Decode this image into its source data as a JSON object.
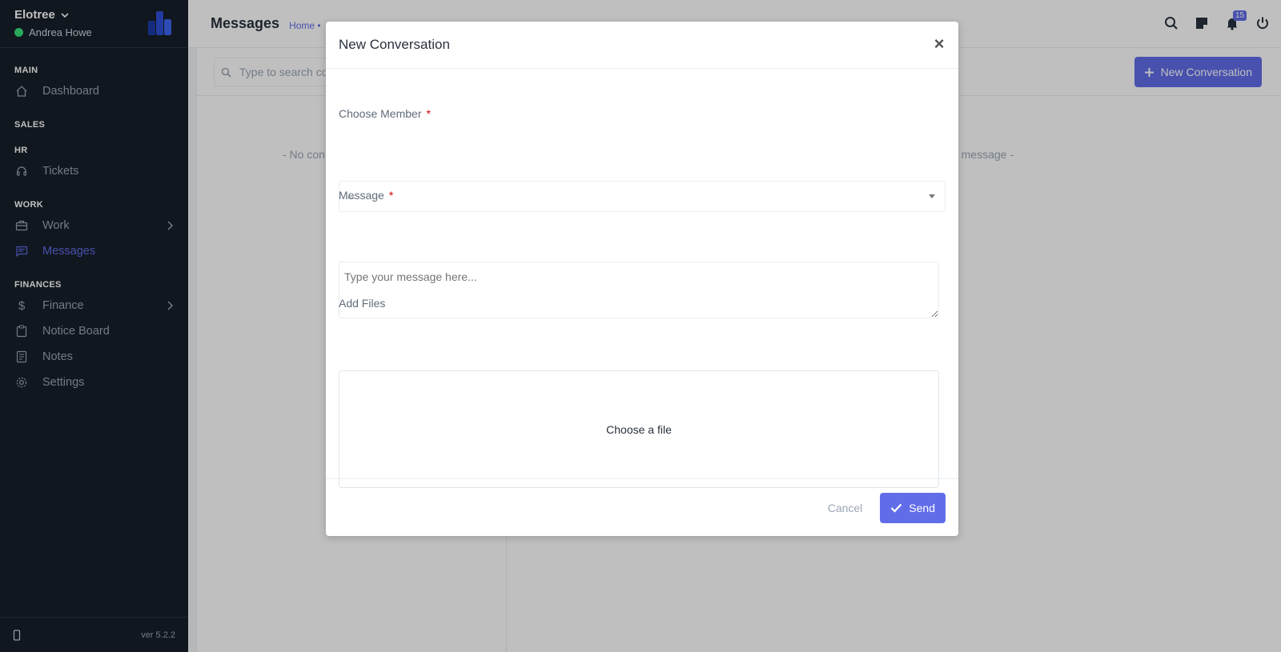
{
  "sidebar": {
    "company": "Elotree",
    "user_name": "Andrea Howe",
    "sections": {
      "main": "MAIN",
      "sales": "SALES",
      "hr": "HR",
      "work": "WORK",
      "finances": "FINANCES"
    },
    "items": {
      "dashboard": "Dashboard",
      "tickets": "Tickets",
      "work": "Work",
      "messages": "Messages",
      "finance": "Finance",
      "notice_board": "Notice Board",
      "notes": "Notes",
      "settings": "Settings"
    },
    "version": "ver 5.2.2"
  },
  "header": {
    "title": "Messages",
    "breadcrumb": "Home •",
    "notification_count": "15"
  },
  "toolbar": {
    "search_placeholder": "Type to search co",
    "new_conversation_label": "New Conversation"
  },
  "content": {
    "empty_left": "- No con",
    "empty_right": "message -"
  },
  "modal": {
    "title": "New Conversation",
    "choose_member_label": "Choose Member",
    "choose_member_value": "--",
    "message_label": "Message",
    "message_placeholder": "Type your message here...",
    "add_files_label": "Add Files",
    "dropzone_text": "Choose a file",
    "cancel_label": "Cancel",
    "send_label": "Send",
    "required_mark": "*"
  },
  "colors": {
    "accent": "#616de8",
    "sidebar_bg": "#171f29",
    "online": "#39e07a",
    "required": "#d30000"
  }
}
